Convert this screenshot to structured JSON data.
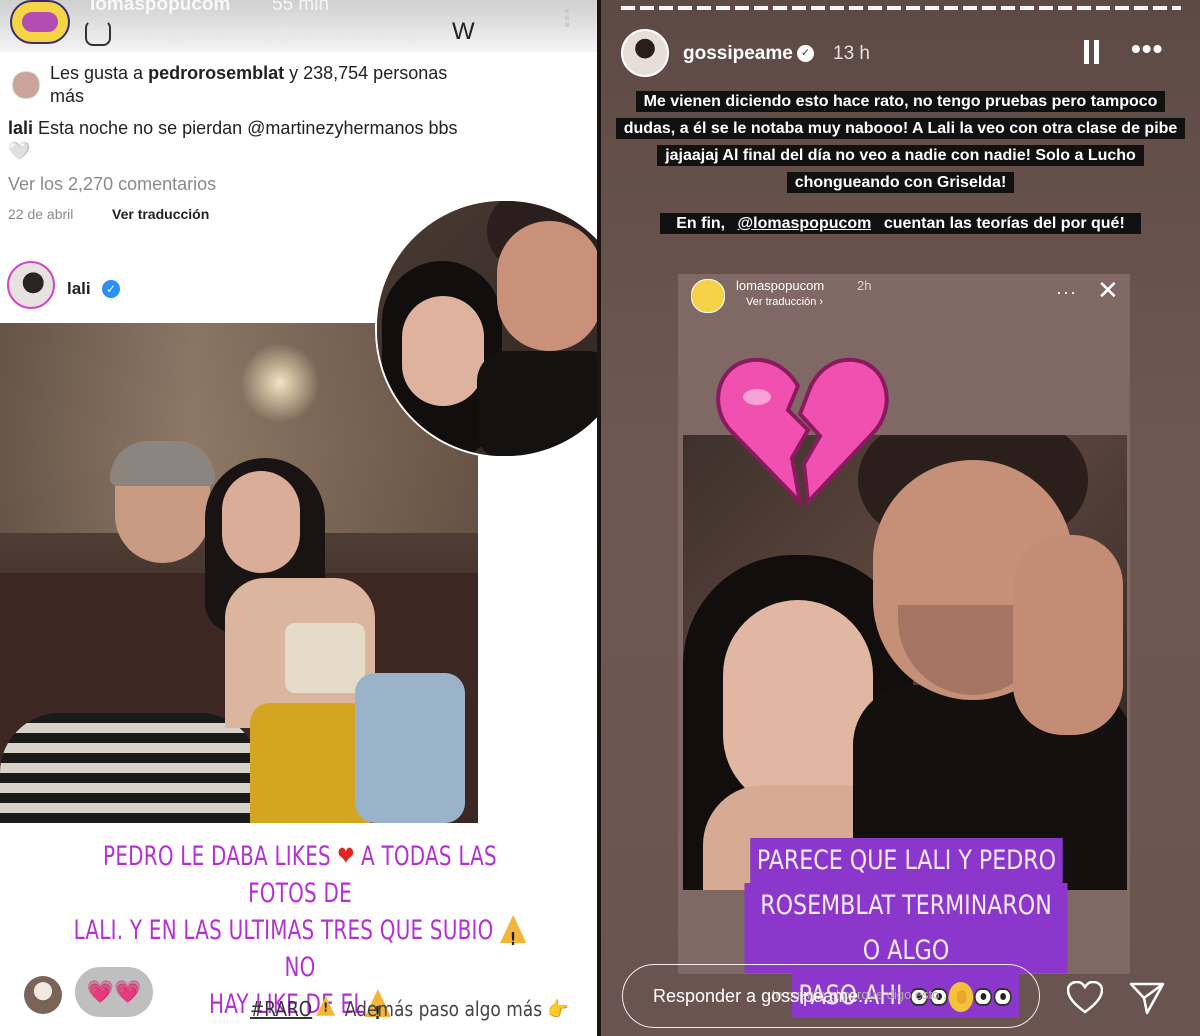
{
  "left_story": {
    "account": "lomaspopucom",
    "time": "55 min",
    "music": "TeenAngels · Me Voy (feat. Mariana Esp...",
    "likes_prefix": "Les gusta a ",
    "likes_user": "pedrorosemblat",
    "likes_suffix": " y 238,754 personas más",
    "caption_user": "lali",
    "caption_text": " Esta noche no se pierdan @martinezyhermanos bbs🤍",
    "comments_link": "Ver los 2,270 comentarios",
    "post_date": "22 de abril",
    "translate_link": "Ver traducción",
    "post_author": "lali",
    "overlay_line1": "PEDRO LE DABA LIKES",
    "overlay_line1b": " A TODAS LAS FOTOS DE",
    "overlay_line2": "LALI. Y EN LAS ULTIMAS TRES QUE SUBIO",
    "overlay_line2b": "NO",
    "overlay_line3": "HAY LIKE DE EL",
    "reply_bubble": "💗💗",
    "raro_tag": "#RARO",
    "raro_rest": " Además paso algo más ",
    "hand_emoji": "👉"
  },
  "right_story": {
    "account": "gossipeame",
    "time": "13 h",
    "text_block1": "Me vienen diciendo esto hace rato, no tengo pruebas pero tampoco dudas, a él se le notaba muy nabooo! A Lali la veo con otra clase de pibe jajaajaj Al final del día no veo a nadie con nadie! Solo a Lucho chongueando con Griselda!",
    "text_block2_prefix": "En fin, ",
    "text_block2_mention": "@lomaspopucom",
    "text_block2_suffix": " cuentan las teorías del por qué!",
    "card_account": "lomaspopucom",
    "card_time": "2h",
    "card_translate": "Ver traducción ›",
    "overlay_line1": "PARECE QUE LALI Y PEDRO",
    "overlay_line2": "ROSEMBLAT TERMINARON O ALGO",
    "overlay_line3": "PASO AHI",
    "reply_placeholder": "Responder a gossipeame...",
    "reply_ghost": "...te cuento el porque digo esto...",
    "icons": [
      "pause-icon",
      "more-icon",
      "close-icon",
      "heart-icon",
      "send-icon",
      "broken-heart-icon",
      "verified-icon"
    ]
  },
  "colors": {
    "overlay_purple": "#b52fd6",
    "overlay_bg_purple": "#8b37cc",
    "verified_blue": "#2a8ef5",
    "warning_yellow": "#f3b43a"
  }
}
